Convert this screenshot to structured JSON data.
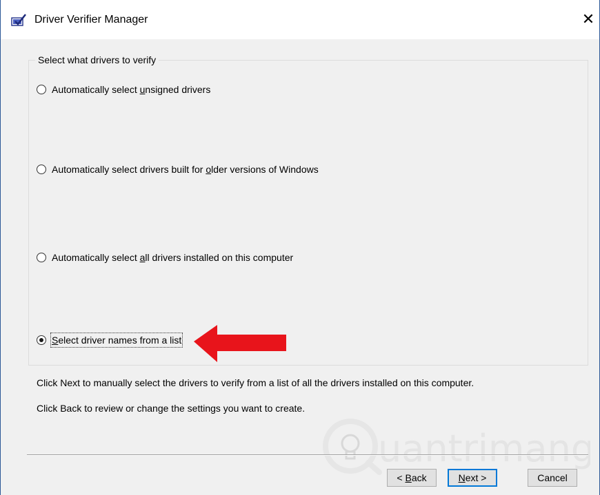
{
  "window": {
    "title": "Driver Verifier Manager",
    "close_glyph": "✕"
  },
  "group": {
    "legend": "Select what drivers to verify"
  },
  "options": [
    {
      "label_pre": "Automatically select ",
      "access_key": "u",
      "label_post": "nsigned drivers",
      "selected": false
    },
    {
      "label_pre": "Automatically select drivers built for ",
      "access_key": "o",
      "label_post": "lder versions of Windows",
      "selected": false
    },
    {
      "label_pre": "Automatically select ",
      "access_key": "a",
      "label_post": "ll drivers installed on this computer",
      "selected": false
    },
    {
      "label_pre": "",
      "access_key": "S",
      "label_post": "elect driver names from a list",
      "selected": true
    }
  ],
  "descriptions": {
    "next_info": "Click Next to manually select the drivers to verify from a list of all the drivers installed on this computer.",
    "back_info": "Click Back to review or change the settings you want to create."
  },
  "buttons": {
    "back": {
      "prefix": "< ",
      "key": "B",
      "rest": "ack"
    },
    "next": {
      "prefix": "",
      "key": "N",
      "rest": "ext >"
    },
    "cancel": "Cancel"
  },
  "watermark": {
    "text": "uantrimang"
  },
  "colors": {
    "arrow": "#e8141b",
    "accent": "#0078d7"
  },
  "icons": {
    "title": "driver-verifier-icon",
    "close": "close-icon"
  }
}
